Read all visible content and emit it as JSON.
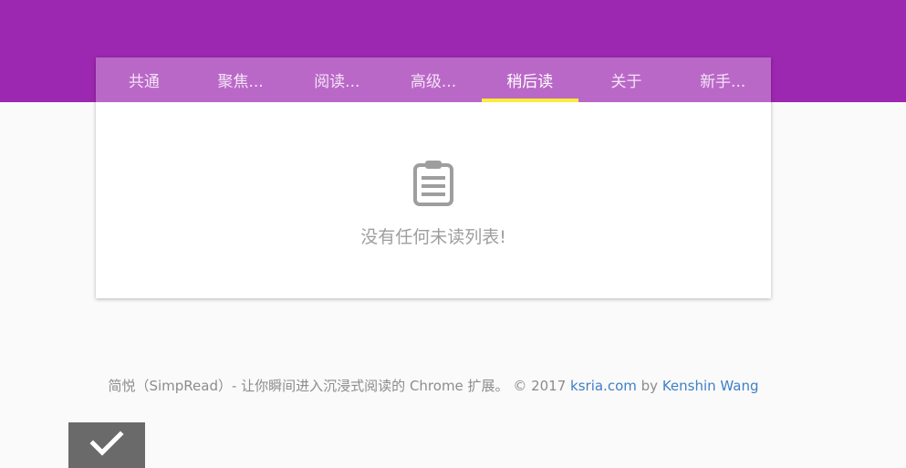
{
  "colors": {
    "header": "#9c27b0",
    "tabbar": "#ba68c8",
    "tab_indicator": "#ffeb3b",
    "link": "#3f7fc6"
  },
  "tabs": [
    {
      "label": "共通"
    },
    {
      "label": "聚焦..."
    },
    {
      "label": "阅读..."
    },
    {
      "label": "高级..."
    },
    {
      "label": "稍后读",
      "active": true
    },
    {
      "label": "关于"
    },
    {
      "label": "新手..."
    }
  ],
  "empty_state": {
    "icon": "clipboard-icon",
    "message": "没有任何未读列表!"
  },
  "footer": {
    "text": "简悦（SimpRead）- 让你瞬间进入沉浸式阅读的 Chrome 扩展。 © 2017 ",
    "link1": "ksria.com",
    "by": " by ",
    "link2": "Kenshin Wang"
  },
  "fab": {
    "icon": "check-icon"
  }
}
